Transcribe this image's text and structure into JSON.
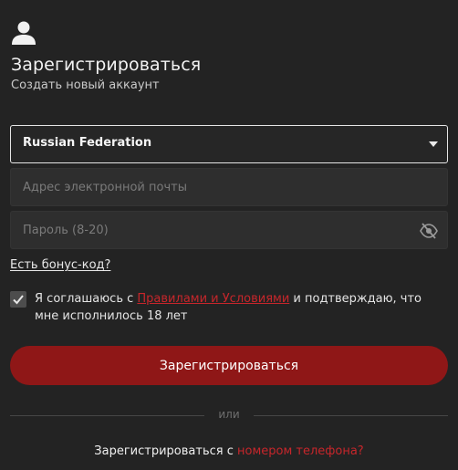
{
  "icons": {
    "user": "user-icon",
    "caret": "caret-down-icon",
    "password_toggle": "eye-slash-icon",
    "checkbox": "check-icon"
  },
  "colors": {
    "background": "#232323",
    "accent": "#8f1717",
    "link": "#c7262b"
  },
  "header": {
    "title": "Зарегистрироваться",
    "subtitle": "Создать новый аккаунт"
  },
  "form": {
    "country": {
      "value": "Russian Federation"
    },
    "email": {
      "value": "",
      "placeholder": "Адрес электронной почты"
    },
    "password": {
      "value": "",
      "placeholder": "Пароль (8-20)"
    },
    "bonus_link": "Есть бонус-код?",
    "agreement": {
      "checked": true,
      "text_before": "Я соглашаюсь с ",
      "terms_link": "Правилами и Условиями",
      "text_after": " и подтверждаю, что мне исполнилось 18 лет"
    },
    "submit_label": "Зарегистрироваться"
  },
  "divider": {
    "label": "или"
  },
  "phone_register": {
    "text": "Зарегистрироваться с ",
    "link": "номером телефона?"
  }
}
